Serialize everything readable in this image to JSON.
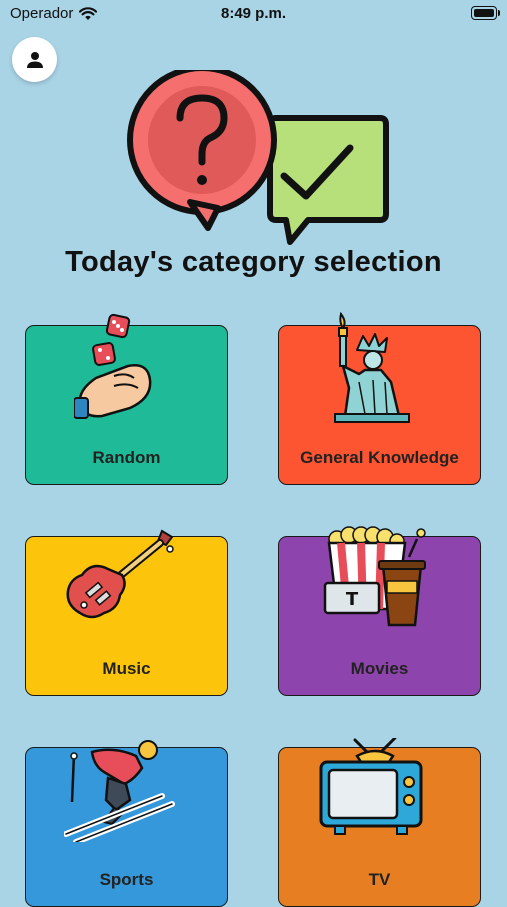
{
  "status_bar": {
    "carrier": "Operador",
    "time": "8:49 p.m."
  },
  "header": {
    "title": "Today's category selection"
  },
  "categories": [
    {
      "label": "Random",
      "color": "#1fbb98",
      "icon": "dice-hand-icon"
    },
    {
      "label": "General Knowledge",
      "color": "#fd5432",
      "icon": "statue-of-liberty-icon"
    },
    {
      "label": "Music",
      "color": "#fcc40a",
      "icon": "electric-guitar-icon"
    },
    {
      "label": "Movies",
      "color": "#8e44ad",
      "icon": "popcorn-ticket-icon"
    },
    {
      "label": "Sports",
      "color": "#3598db",
      "icon": "skier-icon"
    },
    {
      "label": "TV",
      "color": "#e77f22",
      "icon": "television-icon"
    }
  ]
}
